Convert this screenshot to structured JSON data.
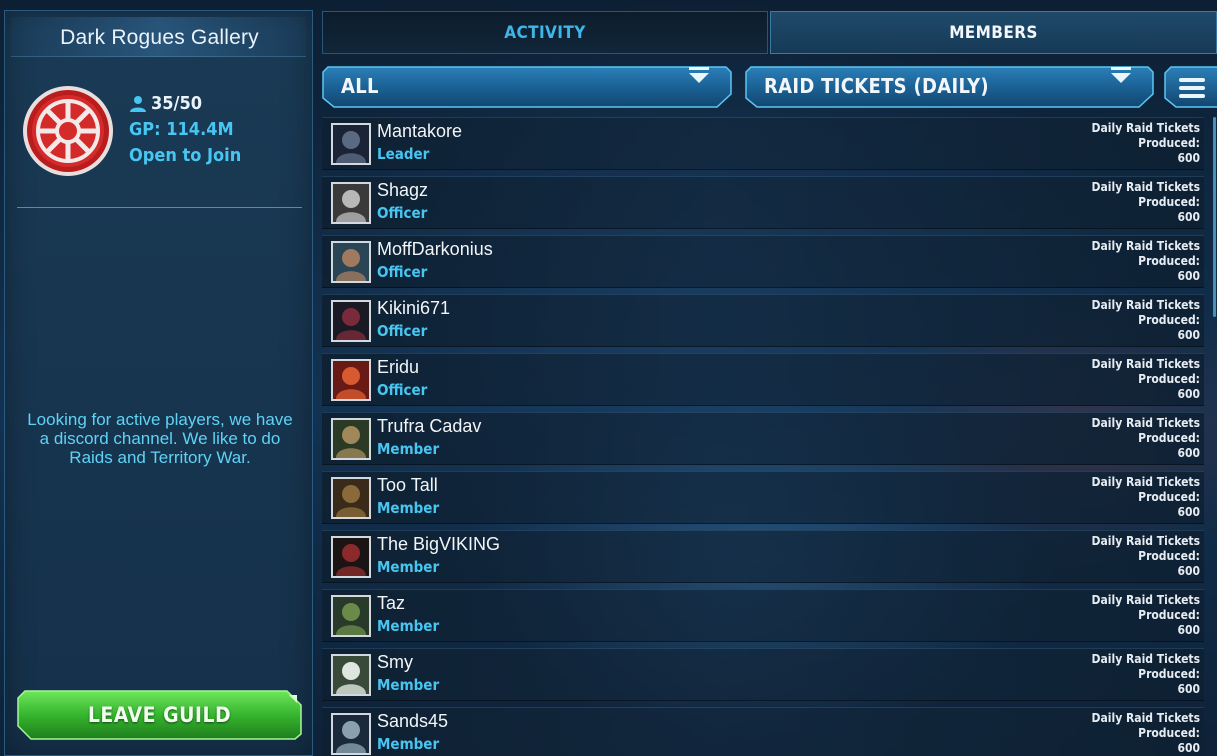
{
  "guild": {
    "name": "Dark Rogues Gallery",
    "members_count": "35/50",
    "gp": "GP: 114.4M",
    "join_status": "Open to Join",
    "description": "Looking for active players, we have a discord channel. We like to do Raids and Territory War.",
    "emblem_icon": "imperial-crest-icon",
    "leave_button_label": "LEAVE GUILD"
  },
  "tabs": [
    {
      "label": "ACTIVITY",
      "active": false
    },
    {
      "label": "MEMBERS",
      "active": true
    }
  ],
  "filters": {
    "role_filter": "ALL",
    "stat_filter": "RAID TICKETS (DAILY)",
    "sort_icon": "list-menu-icon"
  },
  "ticket_label_line1": "Daily Raid Tickets",
  "ticket_label_line2": "Produced:",
  "members": [
    {
      "name": "Mantakore",
      "role": "Leader",
      "tickets": "600",
      "avatar": "sith-emperor-portrait"
    },
    {
      "name": "Shagz",
      "role": "Officer",
      "tickets": "600",
      "avatar": "helmeted-warrior-portrait"
    },
    {
      "name": "MoffDarkonius",
      "role": "Officer",
      "tickets": "600",
      "avatar": "officer-portrait"
    },
    {
      "name": "Kikini671",
      "role": "Officer",
      "tickets": "600",
      "avatar": "hooded-figure-portrait"
    },
    {
      "name": "Eridu",
      "role": "Officer",
      "tickets": "600",
      "avatar": "red-guard-portrait"
    },
    {
      "name": "Trufra Cadav",
      "role": "Member",
      "tickets": "600",
      "avatar": "alien-elder-portrait"
    },
    {
      "name": "Too Tall",
      "role": "Member",
      "tickets": "600",
      "avatar": "alien-warrior-portrait"
    },
    {
      "name": "The BigVIKING",
      "role": "Member",
      "tickets": "600",
      "avatar": "dark-lord-portrait"
    },
    {
      "name": "Taz",
      "role": "Member",
      "tickets": "600",
      "avatar": "bounty-hunter-portrait"
    },
    {
      "name": "Smy",
      "role": "Member",
      "tickets": "600",
      "avatar": "clone-trooper-portrait"
    },
    {
      "name": "Sands45",
      "role": "Member",
      "tickets": "600",
      "avatar": "starfighter-portrait"
    }
  ],
  "colors": {
    "accent_cyan": "#47c6f2",
    "leave_green": "#3fbf3a",
    "panel_bg": "#183650"
  }
}
